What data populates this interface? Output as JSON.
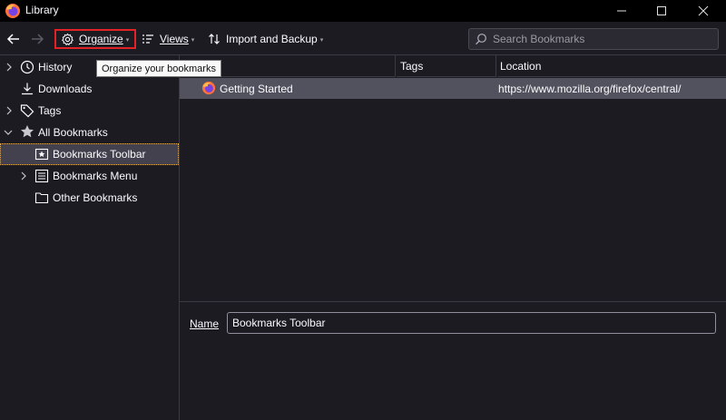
{
  "window": {
    "title": "Library",
    "logo_icon": "firefox-logo-icon"
  },
  "window_controls": {
    "minimize": "─",
    "maximize": "☐",
    "close": "✕"
  },
  "toolbar": {
    "back_icon": "back-arrow-icon",
    "forward_icon": "forward-arrow-icon",
    "organize_label": "Organize",
    "views_label": "Views",
    "import_label": "Import and Backup",
    "dropdown_glyph": "▾"
  },
  "search": {
    "placeholder": "Search Bookmarks",
    "value": ""
  },
  "tooltip": {
    "text": "Organize your bookmarks"
  },
  "sidebar": {
    "items": [
      {
        "label": "History",
        "icon": "clock-icon",
        "twisty": "›"
      },
      {
        "label": "Downloads",
        "icon": "download-icon",
        "twisty": ""
      },
      {
        "label": "Tags",
        "icon": "tag-icon",
        "twisty": "›"
      },
      {
        "label": "All Bookmarks",
        "icon": "star-icon",
        "twisty": "⌄"
      },
      {
        "label": "Bookmarks Toolbar",
        "icon": "bookmarks-toolbar-icon",
        "twisty": "",
        "selected": true
      },
      {
        "label": "Bookmarks Menu",
        "icon": "bookmarks-menu-icon",
        "twisty": "›"
      },
      {
        "label": "Other Bookmarks",
        "icon": "folder-icon",
        "twisty": ""
      }
    ]
  },
  "table": {
    "columns": {
      "name": "",
      "tags": "Tags",
      "location": "Location"
    },
    "rows": [
      {
        "name": "Getting Started",
        "tags": "",
        "location": "https://www.mozilla.org/firefox/central/",
        "icon": "firefox-logo-icon",
        "selected": true
      }
    ]
  },
  "details": {
    "name_label": "Name",
    "name_value": "Bookmarks Toolbar"
  },
  "colors": {
    "background": "#1c1b22",
    "titlebar": "#000000",
    "selected_row": "#52525e",
    "highlight_border": "#e22227",
    "focus_outline": "#e8b04a"
  }
}
